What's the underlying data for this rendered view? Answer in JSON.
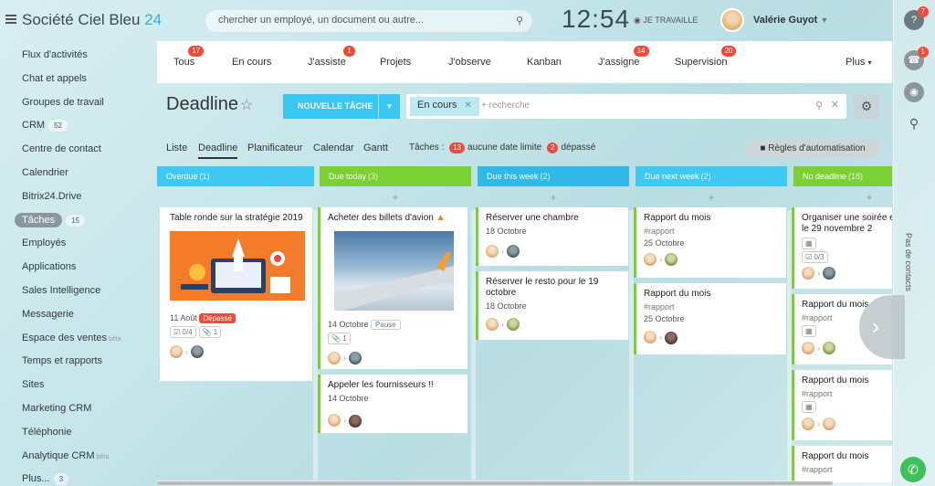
{
  "header": {
    "brand": "Société Ciel Bleu",
    "brand_num": "24",
    "search_placeholder": "chercher un employé, un document ou autre...",
    "clock": "12:54",
    "work_status": "JE TRAVAILLE",
    "user": "Valérie Guyot"
  },
  "sidebar": {
    "items": [
      {
        "label": "Flux d'activités"
      },
      {
        "label": "Chat et appels"
      },
      {
        "label": "Groupes de travail"
      },
      {
        "label": "CRM",
        "count": "52"
      },
      {
        "label": "Centre de contact"
      },
      {
        "label": "Calendrier"
      },
      {
        "label": "Bitrix24.Drive"
      },
      {
        "label": "Tâches",
        "count": "15",
        "active": true
      },
      {
        "label": "Employés"
      },
      {
        "label": "Applications"
      },
      {
        "label": "Sales Intelligence"
      },
      {
        "label": "Messagerie"
      },
      {
        "label": "Espace des ventes",
        "sup": "bêta"
      },
      {
        "label": "Temps et rapports"
      },
      {
        "label": "Sites"
      },
      {
        "label": "Marketing CRM"
      },
      {
        "label": "Téléphonie"
      },
      {
        "label": "Analytique CRM",
        "sup": "bêta"
      },
      {
        "label": "Plus...",
        "count": "3"
      }
    ]
  },
  "tabs": {
    "all": {
      "label": "Tous",
      "badge": "17"
    },
    "in_progress": {
      "label": "En cours"
    },
    "assisting": {
      "label": "J'assiste",
      "badge": "1"
    },
    "projects": {
      "label": "Projets"
    },
    "following": {
      "label": "J'observe"
    },
    "kanban": {
      "label": "Kanban"
    },
    "assigning": {
      "label": "J'assigne",
      "badge": "14"
    },
    "supervision": {
      "label": "Supervision",
      "badge": "20"
    },
    "more": {
      "label": "Plus"
    }
  },
  "toolbar": {
    "title": "Deadline",
    "new_task": "NOUVELLE TÂCHE",
    "filter_chip": "En cours",
    "search_placeholder": "+ recherche"
  },
  "views": {
    "list": "Liste",
    "deadline": "Deadline",
    "planner": "Planificateur",
    "calendar": "Calendar",
    "gantt": "Gantt"
  },
  "stats": {
    "label": "Tâches :",
    "no_deadline_count": "13",
    "no_deadline_label": "aucune date limite",
    "overdue_count": "2",
    "overdue_label": "dépassé"
  },
  "automation": "Règles d'automatisation",
  "right_rail": {
    "help_badge": "7",
    "notif_badge": "1",
    "no_contacts": "Pas de contacts"
  },
  "columns": [
    {
      "label": "Overdue",
      "count": "(1)",
      "color": "#3fc8f2"
    },
    {
      "label": "Due today",
      "count": "(3)",
      "color": "#7bd034"
    },
    {
      "label": "Due this week",
      "count": "(2)",
      "color": "#2fb8e8"
    },
    {
      "label": "Due next week",
      "count": "(2)",
      "color": "#3fc8f2"
    },
    {
      "label": "No deadline",
      "count": "(18)",
      "color": "#7bd034"
    }
  ],
  "cards": {
    "c1": {
      "title": "Table ronde sur la stratégie 2019",
      "date": "11 Août",
      "badge": "Dépassé",
      "check": "0/4",
      "files": "1"
    },
    "c2": {
      "title": "Acheter des billets d'avion",
      "date": "14 Octobre",
      "pause": "Pause",
      "files": "1"
    },
    "c3": {
      "title": "Appeler les fournisseurs !!",
      "date": "14 Octobre"
    },
    "c4": {
      "title": "Réserver une chambre",
      "date": "18 Octobre"
    },
    "c5": {
      "title": "Réserver le resto pour le 19 octobre",
      "date": "18 Octobre"
    },
    "c6": {
      "title": "Rapport du mois",
      "tag": "#rapport",
      "date": "25 Octobre"
    },
    "c7": {
      "title": "Rapport du mois",
      "tag": "#rapport",
      "date": "25 Octobre"
    },
    "c8": {
      "title": "Organiser une soirée en",
      "title2": "le 29 novembre 2",
      "check": "0/3"
    },
    "c9": {
      "title": "Rapport du mois",
      "tag": "#rapport"
    },
    "c10": {
      "title": "Rapport du mois",
      "tag": "#rapport"
    },
    "c11": {
      "title": "Rapport du mois",
      "tag": "#rapport"
    }
  }
}
